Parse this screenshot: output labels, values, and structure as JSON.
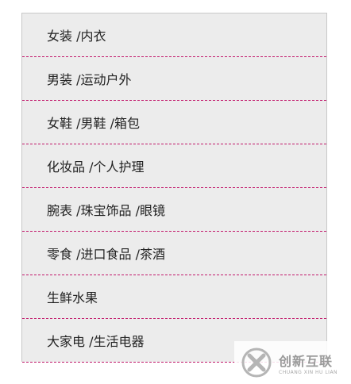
{
  "menu": {
    "items": [
      {
        "label": "女装 /内衣"
      },
      {
        "label": "男装 /运动户外"
      },
      {
        "label": "女鞋 /男鞋 /箱包"
      },
      {
        "label": "化妆品 /个人护理"
      },
      {
        "label": "腕表 /珠宝饰品 /眼镜"
      },
      {
        "label": "零食 /进口食品 /茶酒"
      },
      {
        "label": "生鲜水果"
      },
      {
        "label": "大家电 /生活电器"
      }
    ]
  },
  "watermark": {
    "title": "创新互联",
    "subtitle": "CHUANG XIN HU LIAN",
    "logo_icon": "x-logo-icon"
  }
}
